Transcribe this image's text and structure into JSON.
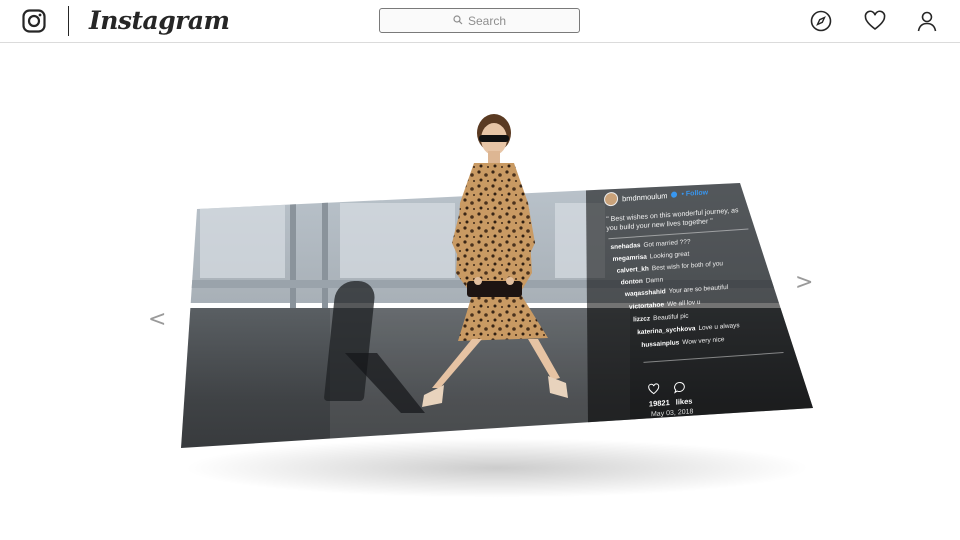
{
  "header": {
    "brand": "Instagram",
    "search_placeholder": "Search",
    "icons": [
      "instagram-glyph-icon",
      "search-icon",
      "compass-icon",
      "heart-icon",
      "person-icon"
    ]
  },
  "nav": {
    "prev": "<",
    "next": ">"
  },
  "post": {
    "username": "bmdnmoulum",
    "follow": "• Follow",
    "caption": "\" Best wishes on this wonderful journey, as you build your new lives together \"",
    "comments": [
      {
        "user": "snehadas",
        "text": "Got married ???"
      },
      {
        "user": "megamrisa",
        "text": "Looking great"
      },
      {
        "user": "calvert_kh",
        "text": "Best wish for both of you"
      },
      {
        "user": "donton",
        "text": "Damn"
      },
      {
        "user": "waqasshahid",
        "text": "Your are so beautiful"
      },
      {
        "user": "victortahoe",
        "text": "We all lov u"
      },
      {
        "user": "lizzcz",
        "text": "Beautiful pic"
      },
      {
        "user": "katerina_sychkova",
        "text": "Love u always"
      },
      {
        "user": "hussainplus",
        "text": "Wow very nice"
      }
    ],
    "likes_count": "19821",
    "likes_label": "likes",
    "date": "May 03, 2018"
  },
  "colors": {
    "accent": "#3897f0",
    "text": "#262626",
    "border": "#dbdbdb"
  }
}
